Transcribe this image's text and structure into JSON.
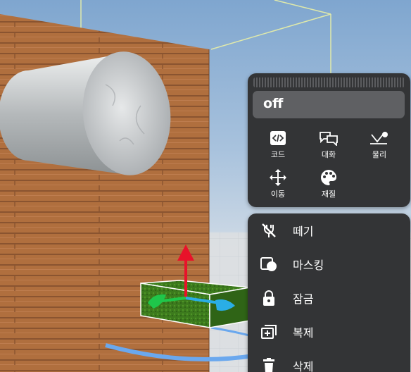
{
  "object_panel": {
    "name_value": "off",
    "tools": [
      {
        "label": "코드",
        "icon": "code-icon"
      },
      {
        "label": "대화",
        "icon": "chat-icon"
      },
      {
        "label": "물리",
        "icon": "physics-icon"
      },
      {
        "label": "이동",
        "icon": "move-icon"
      },
      {
        "label": "재질",
        "icon": "palette-icon"
      }
    ]
  },
  "action_menu": {
    "items": [
      {
        "label": "떼기",
        "icon": "detach-icon"
      },
      {
        "label": "마스킹",
        "icon": "masking-icon"
      },
      {
        "label": "잠금",
        "icon": "lock-icon"
      },
      {
        "label": "복제",
        "icon": "duplicate-icon"
      },
      {
        "label": "삭제",
        "icon": "trash-icon"
      }
    ]
  },
  "colors": {
    "panel_bg": "#333436",
    "field_bg": "#5f6063",
    "gizmo_up": "#e8122a",
    "gizmo_green": "#1fc64a",
    "gizmo_blue": "#2aaee6"
  }
}
